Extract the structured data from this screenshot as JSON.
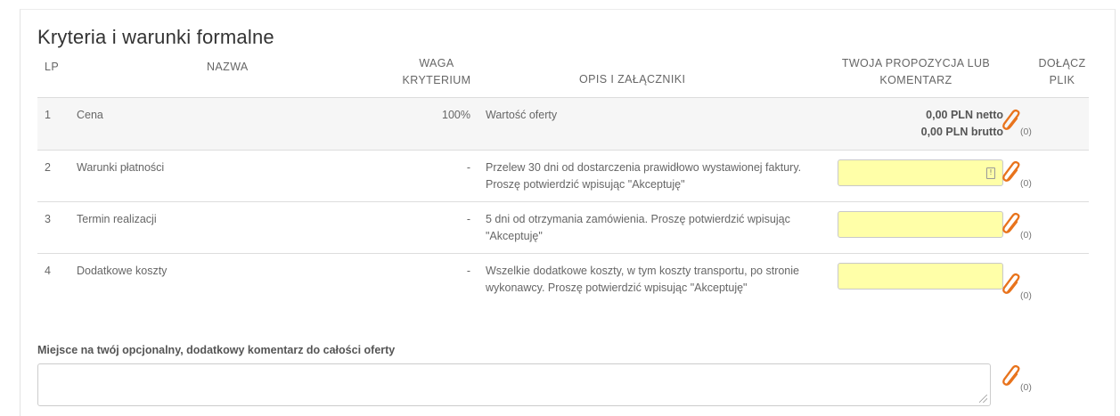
{
  "section": {
    "title": "Kryteria i warunki formalne"
  },
  "table": {
    "headers": {
      "lp": "LP",
      "name": "NAZWA",
      "weight_line1": "WAGA",
      "weight_line2": "KRYTERIUM",
      "desc": "OPIS I ZAŁĄCZNIKI",
      "proposal_line1": "TWOJA PROPOZYCJA LUB",
      "proposal_line2": "KOMENTARZ",
      "attach_line1": "DOŁĄCZ",
      "attach_line2": "PLIK"
    },
    "rows": [
      {
        "lp": "1",
        "name": "Cena",
        "weight": "100%",
        "desc": "Wartość oferty",
        "price_net": "0,00 PLN netto",
        "price_gross": "0,00 PLN brutto",
        "attach_count": "(0)"
      },
      {
        "lp": "2",
        "name": "Warunki płatności",
        "weight": "-",
        "desc": "Przelew 30 dni od dostarczenia prawidłowo wystawionej faktury. Proszę potwierdzić wpisując \"Akceptuję\"",
        "input_value": "",
        "attach_count": "(0)"
      },
      {
        "lp": "3",
        "name": "Termin realizacji",
        "weight": "-",
        "desc": "5 dni od otrzymania zamówienia. Proszę potwierdzić wpisując \"Akceptuję\"",
        "input_value": "",
        "attach_count": "(0)"
      },
      {
        "lp": "4",
        "name": "Dodatkowe koszty",
        "weight": "-",
        "desc": "Wszelkie dodatkowe koszty, w tym koszty transportu, po stronie wykonawcy. Proszę potwierdzić wpisując \"Akceptuję\"",
        "input_value": "",
        "attach_count": "(0)"
      }
    ]
  },
  "footer": {
    "label": "Miejsce na twój opcjonalny, dodatkowy komentarz do całości oferty",
    "comment_value": "",
    "attach_count": "(0)"
  },
  "colors": {
    "accent_clip": "#e8731c",
    "input_bg": "#ffffa8"
  },
  "icons": {
    "attach": "paperclip-icon",
    "field_hint": "info-icon",
    "resize": "resize-handle-icon"
  }
}
